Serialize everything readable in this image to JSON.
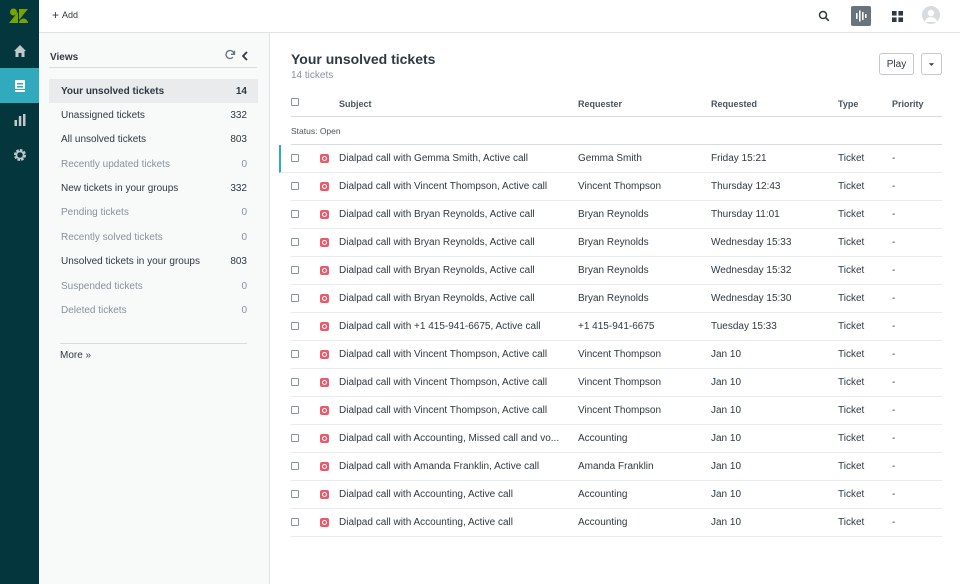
{
  "topbar": {
    "add_label": "Add"
  },
  "views": {
    "title": "Views",
    "items": [
      {
        "label": "Your unsolved tickets",
        "count": "14"
      },
      {
        "label": "Unassigned tickets",
        "count": "332"
      },
      {
        "label": "All unsolved tickets",
        "count": "803"
      },
      {
        "label": "Recently updated tickets",
        "count": "0"
      },
      {
        "label": "New tickets in your groups",
        "count": "332"
      },
      {
        "label": "Pending tickets",
        "count": "0"
      },
      {
        "label": "Recently solved tickets",
        "count": "0"
      },
      {
        "label": "Unsolved tickets in your groups",
        "count": "803"
      },
      {
        "label": "Suspended tickets",
        "count": "0"
      },
      {
        "label": "Deleted tickets",
        "count": "0"
      }
    ],
    "more_label": "More »"
  },
  "main": {
    "title": "Your unsolved tickets",
    "count_label": "14 tickets",
    "play_label": "Play",
    "columns": {
      "subject": "Subject",
      "requester": "Requester",
      "requested": "Requested",
      "type": "Type",
      "priority": "Priority"
    },
    "group_label": "Status: Open",
    "rows": [
      {
        "subject": "Dialpad call with Gemma Smith, Active call",
        "requester": "Gemma Smith",
        "requested": "Friday 15:21",
        "type": "Ticket",
        "priority": "-"
      },
      {
        "subject": "Dialpad call with Vincent Thompson, Active call",
        "requester": "Vincent Thompson",
        "requested": "Thursday 12:43",
        "type": "Ticket",
        "priority": "-"
      },
      {
        "subject": "Dialpad call with Bryan Reynolds, Active call",
        "requester": "Bryan Reynolds",
        "requested": "Thursday 11:01",
        "type": "Ticket",
        "priority": "-"
      },
      {
        "subject": "Dialpad call with Bryan Reynolds, Active call",
        "requester": "Bryan Reynolds",
        "requested": "Wednesday 15:33",
        "type": "Ticket",
        "priority": "-"
      },
      {
        "subject": "Dialpad call with Bryan Reynolds, Active call",
        "requester": "Bryan Reynolds",
        "requested": "Wednesday 15:32",
        "type": "Ticket",
        "priority": "-"
      },
      {
        "subject": "Dialpad call with Bryan Reynolds, Active call",
        "requester": "Bryan Reynolds",
        "requested": "Wednesday 15:30",
        "type": "Ticket",
        "priority": "-"
      },
      {
        "subject": "Dialpad call with +1 415-941-6675, Active call",
        "requester": "+1 415-941-6675",
        "requested": "Tuesday 15:33",
        "type": "Ticket",
        "priority": "-"
      },
      {
        "subject": "Dialpad call with Vincent Thompson, Active call",
        "requester": "Vincent Thompson",
        "requested": "Jan 10",
        "type": "Ticket",
        "priority": "-"
      },
      {
        "subject": "Dialpad call with Vincent Thompson, Active call",
        "requester": "Vincent Thompson",
        "requested": "Jan 10",
        "type": "Ticket",
        "priority": "-"
      },
      {
        "subject": "Dialpad call with Vincent Thompson, Active call",
        "requester": "Vincent Thompson",
        "requested": "Jan 10",
        "type": "Ticket",
        "priority": "-"
      },
      {
        "subject": "Dialpad call with Accounting, Missed call and vo...",
        "requester": "Accounting",
        "requested": "Jan 10",
        "type": "Ticket",
        "priority": "-"
      },
      {
        "subject": "Dialpad call with Amanda Franklin, Active call",
        "requester": "Amanda Franklin",
        "requested": "Jan 10",
        "type": "Ticket",
        "priority": "-"
      },
      {
        "subject": "Dialpad call with Accounting, Active call",
        "requester": "Accounting",
        "requested": "Jan 10",
        "type": "Ticket",
        "priority": "-"
      },
      {
        "subject": "Dialpad call with Accounting, Active call",
        "requester": "Accounting",
        "requested": "Jan 10",
        "type": "Ticket",
        "priority": "-"
      }
    ]
  },
  "colors": {
    "rail": "#03363d",
    "rail_active": "#30aabc",
    "ticket_icon": "#eb5a6a"
  },
  "icons": [
    "zendesk-logo-icon",
    "home-icon",
    "tickets-icon",
    "reporting-icon",
    "admin-gear-icon",
    "search-icon",
    "voice-icon",
    "apps-grid-icon",
    "avatar-icon",
    "refresh-icon",
    "collapse-icon",
    "chevron-down-icon"
  ]
}
